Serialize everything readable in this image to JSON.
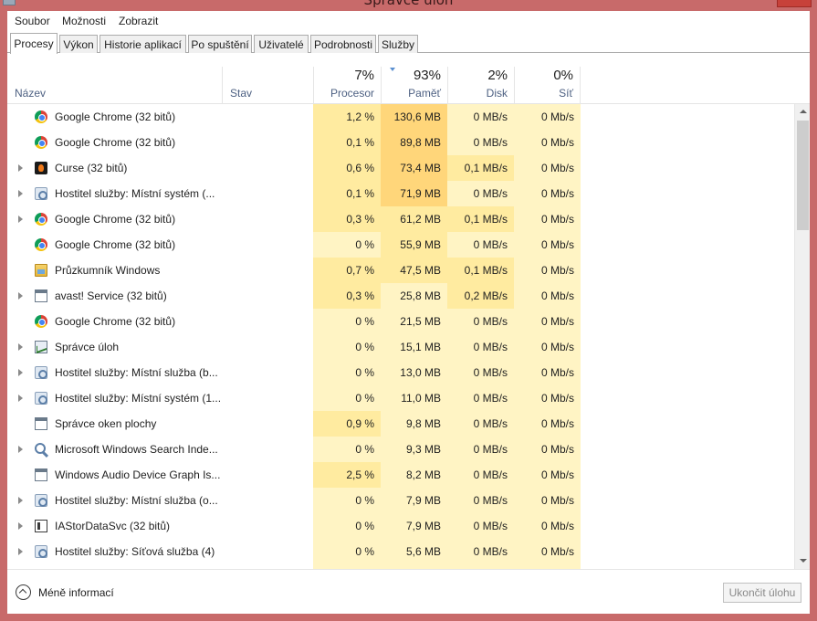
{
  "window": {
    "title": "Správce úloh"
  },
  "menu": [
    "Soubor",
    "Možnosti",
    "Zobrazit"
  ],
  "tabs": [
    {
      "label": "Procesy",
      "active": true
    },
    {
      "label": "Výkon",
      "active": false
    },
    {
      "label": "Historie aplikací",
      "active": false
    },
    {
      "label": "Po spuštění",
      "active": false
    },
    {
      "label": "Uživatelé",
      "active": false
    },
    {
      "label": "Podrobnosti",
      "active": false
    },
    {
      "label": "Služby",
      "active": false
    }
  ],
  "columns": {
    "name": "Název",
    "status": "Stav",
    "cpu": {
      "label": "Procesor",
      "total": "7%"
    },
    "memory": {
      "label": "Paměť",
      "total": "93%",
      "sorted": "descending"
    },
    "disk": {
      "label": "Disk",
      "total": "2%"
    },
    "network": {
      "label": "Síť",
      "total": "0%"
    }
  },
  "processes": [
    {
      "name": "Google Chrome (32 bitů)",
      "icon": "chrome-icon",
      "expandable": false,
      "cpu": "1,2 %",
      "memory": "130,6 MB",
      "disk": "0 MB/s",
      "network": "0 Mb/s"
    },
    {
      "name": "Google Chrome (32 bitů)",
      "icon": "chrome-icon",
      "expandable": false,
      "cpu": "0,1 %",
      "memory": "89,8 MB",
      "disk": "0 MB/s",
      "network": "0 Mb/s"
    },
    {
      "name": "Curse (32 bitů)",
      "icon": "curse-icon",
      "expandable": true,
      "cpu": "0,6 %",
      "memory": "73,4 MB",
      "disk": "0,1 MB/s",
      "network": "0 Mb/s"
    },
    {
      "name": "Hostitel služby: Místní systém (...",
      "icon": "service-host-icon",
      "expandable": true,
      "cpu": "0,1 %",
      "memory": "71,9 MB",
      "disk": "0 MB/s",
      "network": "0 Mb/s"
    },
    {
      "name": "Google Chrome (32 bitů)",
      "icon": "chrome-icon",
      "expandable": true,
      "cpu": "0,3 %",
      "memory": "61,2 MB",
      "disk": "0,1 MB/s",
      "network": "0 Mb/s"
    },
    {
      "name": "Google Chrome (32 bitů)",
      "icon": "chrome-icon",
      "expandable": false,
      "cpu": "0 %",
      "memory": "55,9 MB",
      "disk": "0 MB/s",
      "network": "0 Mb/s"
    },
    {
      "name": "Průzkumník Windows",
      "icon": "explorer-folder-icon",
      "expandable": false,
      "cpu": "0,7 %",
      "memory": "47,5 MB",
      "disk": "0,1 MB/s",
      "network": "0 Mb/s"
    },
    {
      "name": "avast! Service (32 bitů)",
      "icon": "app-window-icon",
      "expandable": true,
      "cpu": "0,3 %",
      "memory": "25,8 MB",
      "disk": "0,2 MB/s",
      "network": "0 Mb/s"
    },
    {
      "name": "Google Chrome (32 bitů)",
      "icon": "chrome-icon",
      "expandable": false,
      "cpu": "0 %",
      "memory": "21,5 MB",
      "disk": "0 MB/s",
      "network": "0 Mb/s"
    },
    {
      "name": "Správce úloh",
      "icon": "task-manager-icon",
      "expandable": true,
      "cpu": "0 %",
      "memory": "15,1 MB",
      "disk": "0 MB/s",
      "network": "0 Mb/s"
    },
    {
      "name": "Hostitel služby: Místní služba (b...",
      "icon": "service-host-icon",
      "expandable": true,
      "cpu": "0 %",
      "memory": "13,0 MB",
      "disk": "0 MB/s",
      "network": "0 Mb/s"
    },
    {
      "name": "Hostitel služby: Místní systém (1...",
      "icon": "service-host-icon",
      "expandable": true,
      "cpu": "0 %",
      "memory": "11,0 MB",
      "disk": "0 MB/s",
      "network": "0 Mb/s"
    },
    {
      "name": "Správce oken plochy",
      "icon": "app-window-icon",
      "expandable": false,
      "cpu": "0,9 %",
      "memory": "9,8 MB",
      "disk": "0 MB/s",
      "network": "0 Mb/s"
    },
    {
      "name": "Microsoft Windows Search Inde...",
      "icon": "search-indexer-icon",
      "expandable": true,
      "cpu": "0 %",
      "memory": "9,3 MB",
      "disk": "0 MB/s",
      "network": "0 Mb/s"
    },
    {
      "name": "Windows Audio Device Graph Is...",
      "icon": "app-window-icon",
      "expandable": false,
      "cpu": "2,5 %",
      "memory": "8,2 MB",
      "disk": "0 MB/s",
      "network": "0 Mb/s"
    },
    {
      "name": "Hostitel služby: Místní služba (o...",
      "icon": "service-host-icon",
      "expandable": true,
      "cpu": "0 %",
      "memory": "7,9 MB",
      "disk": "0 MB/s",
      "network": "0 Mb/s"
    },
    {
      "name": "IAStorDataSvc (32 bitů)",
      "icon": "iastor-icon",
      "expandable": true,
      "cpu": "0 %",
      "memory": "7,9 MB",
      "disk": "0 MB/s",
      "network": "0 Mb/s"
    },
    {
      "name": "Hostitel služby: Síťová služba (4)",
      "icon": "service-host-icon",
      "expandable": true,
      "cpu": "0 %",
      "memory": "5,6 MB",
      "disk": "0 MB/s",
      "network": "0 Mb/s"
    }
  ],
  "footer": {
    "fewer_details": "Méně informací",
    "end_task": "Ukončit úlohu"
  },
  "colors": {
    "titlebar": "#c86a6a",
    "heat_light": "#fff4c4",
    "heat_medium": "#ffeba0",
    "heat_strong": "#ffd67a",
    "close_button": "#c7413a"
  }
}
